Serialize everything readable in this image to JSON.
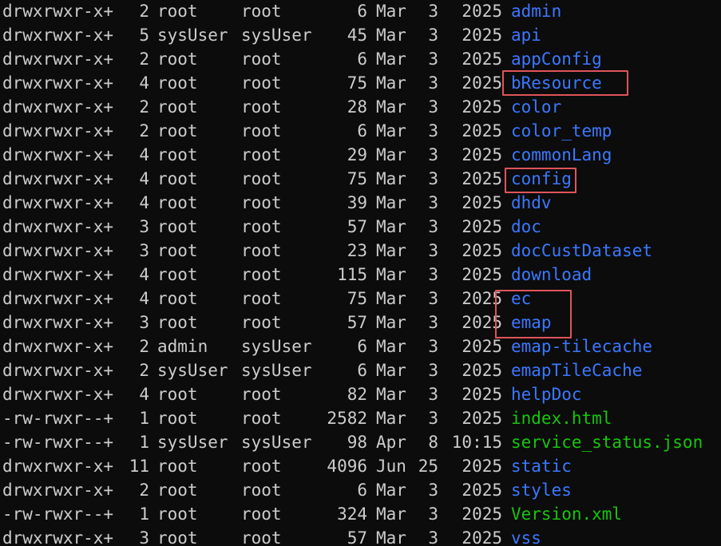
{
  "terminal": {
    "listing": [
      {
        "perm": "drwxrwxr-x+",
        "links": "2",
        "owner": "root",
        "group": "root",
        "size": "6",
        "month": "Mar",
        "day": "3",
        "time": "2025",
        "name": "admin",
        "type": "dir"
      },
      {
        "perm": "drwxrwxr-x+",
        "links": "5",
        "owner": "sysUser",
        "group": "sysUser",
        "size": "45",
        "month": "Mar",
        "day": "3",
        "time": "2025",
        "name": "api",
        "type": "dir"
      },
      {
        "perm": "drwxrwxr-x+",
        "links": "2",
        "owner": "root",
        "group": "root",
        "size": "6",
        "month": "Mar",
        "day": "3",
        "time": "2025",
        "name": "appConfig",
        "type": "dir"
      },
      {
        "perm": "drwxrwxr-x+",
        "links": "4",
        "owner": "root",
        "group": "root",
        "size": "75",
        "month": "Mar",
        "day": "3",
        "time": "2025",
        "name": "bResource",
        "type": "dir"
      },
      {
        "perm": "drwxrwxr-x+",
        "links": "2",
        "owner": "root",
        "group": "root",
        "size": "28",
        "month": "Mar",
        "day": "3",
        "time": "2025",
        "name": "color",
        "type": "dir"
      },
      {
        "perm": "drwxrwxr-x+",
        "links": "2",
        "owner": "root",
        "group": "root",
        "size": "6",
        "month": "Mar",
        "day": "3",
        "time": "2025",
        "name": "color_temp",
        "type": "dir"
      },
      {
        "perm": "drwxrwxr-x+",
        "links": "4",
        "owner": "root",
        "group": "root",
        "size": "29",
        "month": "Mar",
        "day": "3",
        "time": "2025",
        "name": "commonLang",
        "type": "dir"
      },
      {
        "perm": "drwxrwxr-x+",
        "links": "4",
        "owner": "root",
        "group": "root",
        "size": "75",
        "month": "Mar",
        "day": "3",
        "time": "2025",
        "name": "config",
        "type": "dir"
      },
      {
        "perm": "drwxrwxr-x+",
        "links": "4",
        "owner": "root",
        "group": "root",
        "size": "39",
        "month": "Mar",
        "day": "3",
        "time": "2025",
        "name": "dhdv",
        "type": "dir"
      },
      {
        "perm": "drwxrwxr-x+",
        "links": "3",
        "owner": "root",
        "group": "root",
        "size": "57",
        "month": "Mar",
        "day": "3",
        "time": "2025",
        "name": "doc",
        "type": "dir"
      },
      {
        "perm": "drwxrwxr-x+",
        "links": "3",
        "owner": "root",
        "group": "root",
        "size": "23",
        "month": "Mar",
        "day": "3",
        "time": "2025",
        "name": "docCustDataset",
        "type": "dir"
      },
      {
        "perm": "drwxrwxr-x+",
        "links": "4",
        "owner": "root",
        "group": "root",
        "size": "115",
        "month": "Mar",
        "day": "3",
        "time": "2025",
        "name": "download",
        "type": "dir"
      },
      {
        "perm": "drwxrwxr-x+",
        "links": "4",
        "owner": "root",
        "group": "root",
        "size": "75",
        "month": "Mar",
        "day": "3",
        "time": "2025",
        "name": "ec",
        "type": "dir"
      },
      {
        "perm": "drwxrwxr-x+",
        "links": "3",
        "owner": "root",
        "group": "root",
        "size": "57",
        "month": "Mar",
        "day": "3",
        "time": "2025",
        "name": "emap",
        "type": "dir"
      },
      {
        "perm": "drwxrwxr-x+",
        "links": "2",
        "owner": "admin",
        "group": "sysUser",
        "size": "6",
        "month": "Mar",
        "day": "3",
        "time": "2025",
        "name": "emap-tilecache",
        "type": "dir"
      },
      {
        "perm": "drwxrwxr-x+",
        "links": "2",
        "owner": "sysUser",
        "group": "sysUser",
        "size": "6",
        "month": "Mar",
        "day": "3",
        "time": "2025",
        "name": "emapTileCache",
        "type": "dir"
      },
      {
        "perm": "drwxrwxr-x+",
        "links": "4",
        "owner": "root",
        "group": "root",
        "size": "82",
        "month": "Mar",
        "day": "3",
        "time": "2025",
        "name": "helpDoc",
        "type": "dir"
      },
      {
        "perm": "-rw-rwxr--+",
        "links": "1",
        "owner": "root",
        "group": "root",
        "size": "2582",
        "month": "Mar",
        "day": "3",
        "time": "2025",
        "name": "index.html",
        "type": "file"
      },
      {
        "perm": "-rw-rwxr--+",
        "links": "1",
        "owner": "sysUser",
        "group": "sysUser",
        "size": "98",
        "month": "Apr",
        "day": "8",
        "time": "10:15",
        "name": "service_status.json",
        "type": "file"
      },
      {
        "perm": "drwxrwxr-x+",
        "links": "11",
        "owner": "root",
        "group": "root",
        "size": "4096",
        "month": "Jun",
        "day": "25",
        "time": "2025",
        "name": "static",
        "type": "dir"
      },
      {
        "perm": "drwxrwxr-x+",
        "links": "2",
        "owner": "root",
        "group": "root",
        "size": "6",
        "month": "Mar",
        "day": "3",
        "time": "2025",
        "name": "styles",
        "type": "dir"
      },
      {
        "perm": "-rw-rwxr--+",
        "links": "1",
        "owner": "root",
        "group": "root",
        "size": "324",
        "month": "Mar",
        "day": "3",
        "time": "2025",
        "name": "Version.xml",
        "type": "file"
      },
      {
        "perm": "drwxrwxr-x+",
        "links": "3",
        "owner": "root",
        "group": "root",
        "size": "57",
        "month": "Mar",
        "day": "3",
        "time": "2025",
        "name": "vss",
        "type": "dir"
      }
    ],
    "colors": {
      "background": "#0c0c0c",
      "text": "#cccccc",
      "directory": "#3b78ff",
      "file": "#16c60c",
      "highlight_box": "#e0545a"
    },
    "highlighted_entries": [
      "bResource",
      "config",
      "ec",
      "emap"
    ]
  }
}
